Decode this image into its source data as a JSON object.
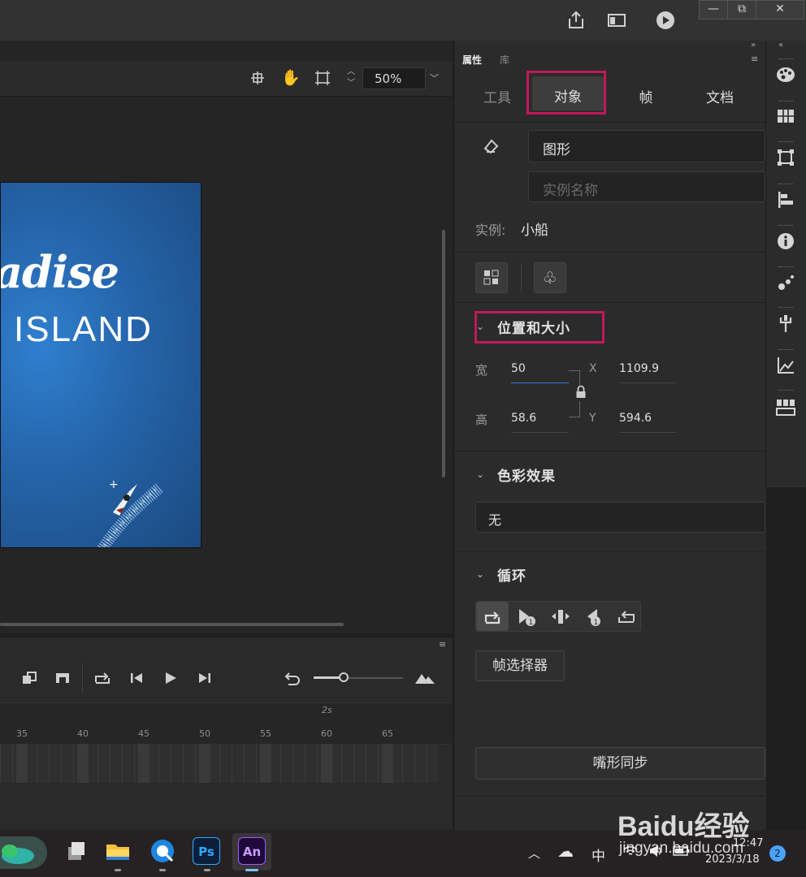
{
  "properties_panel": {
    "panel_tabs": [
      "属性",
      "库"
    ],
    "tabs": [
      "工具",
      "对象",
      "帧",
      "文档"
    ],
    "active_tab": "对象",
    "symbol_type": "图形",
    "instance_name_placeholder": "实例名称",
    "instance_label": "实例:",
    "instance_value": "小船",
    "position_size": {
      "title": "位置和大小",
      "width_label": "宽",
      "width_value": "50",
      "height_label": "高",
      "height_value": "58.6",
      "x_label": "X",
      "x_value": "1109.9",
      "y_label": "Y",
      "y_value": "594.6"
    },
    "color_effect": {
      "title": "色彩效果",
      "value": "无"
    },
    "loop": {
      "title": "循环",
      "frame_picker_label": "帧选择器"
    },
    "lip_sync_label": "嘴形同步"
  },
  "stage": {
    "zoom": "50%",
    "art_title": "adise",
    "art_subtitle": "ISLAND"
  },
  "timeline": {
    "time_marker": "2s",
    "ticks": [
      "35",
      "40",
      "45",
      "50",
      "55",
      "60",
      "65"
    ]
  },
  "window_controls": [
    "—",
    "⧉",
    "✕"
  ],
  "taskbar": {
    "apps": [
      "Ps",
      "An"
    ],
    "ime": "中",
    "time": "12:47",
    "date": "2023/3/18",
    "notification_count": "2"
  },
  "watermark": {
    "brand": "Baidu经验",
    "url": "jingyan.baidu.com"
  },
  "colors": {
    "highlight": "#c2185b",
    "panel_bg": "#2b2b2b",
    "stage_blue": "#2563a8"
  }
}
